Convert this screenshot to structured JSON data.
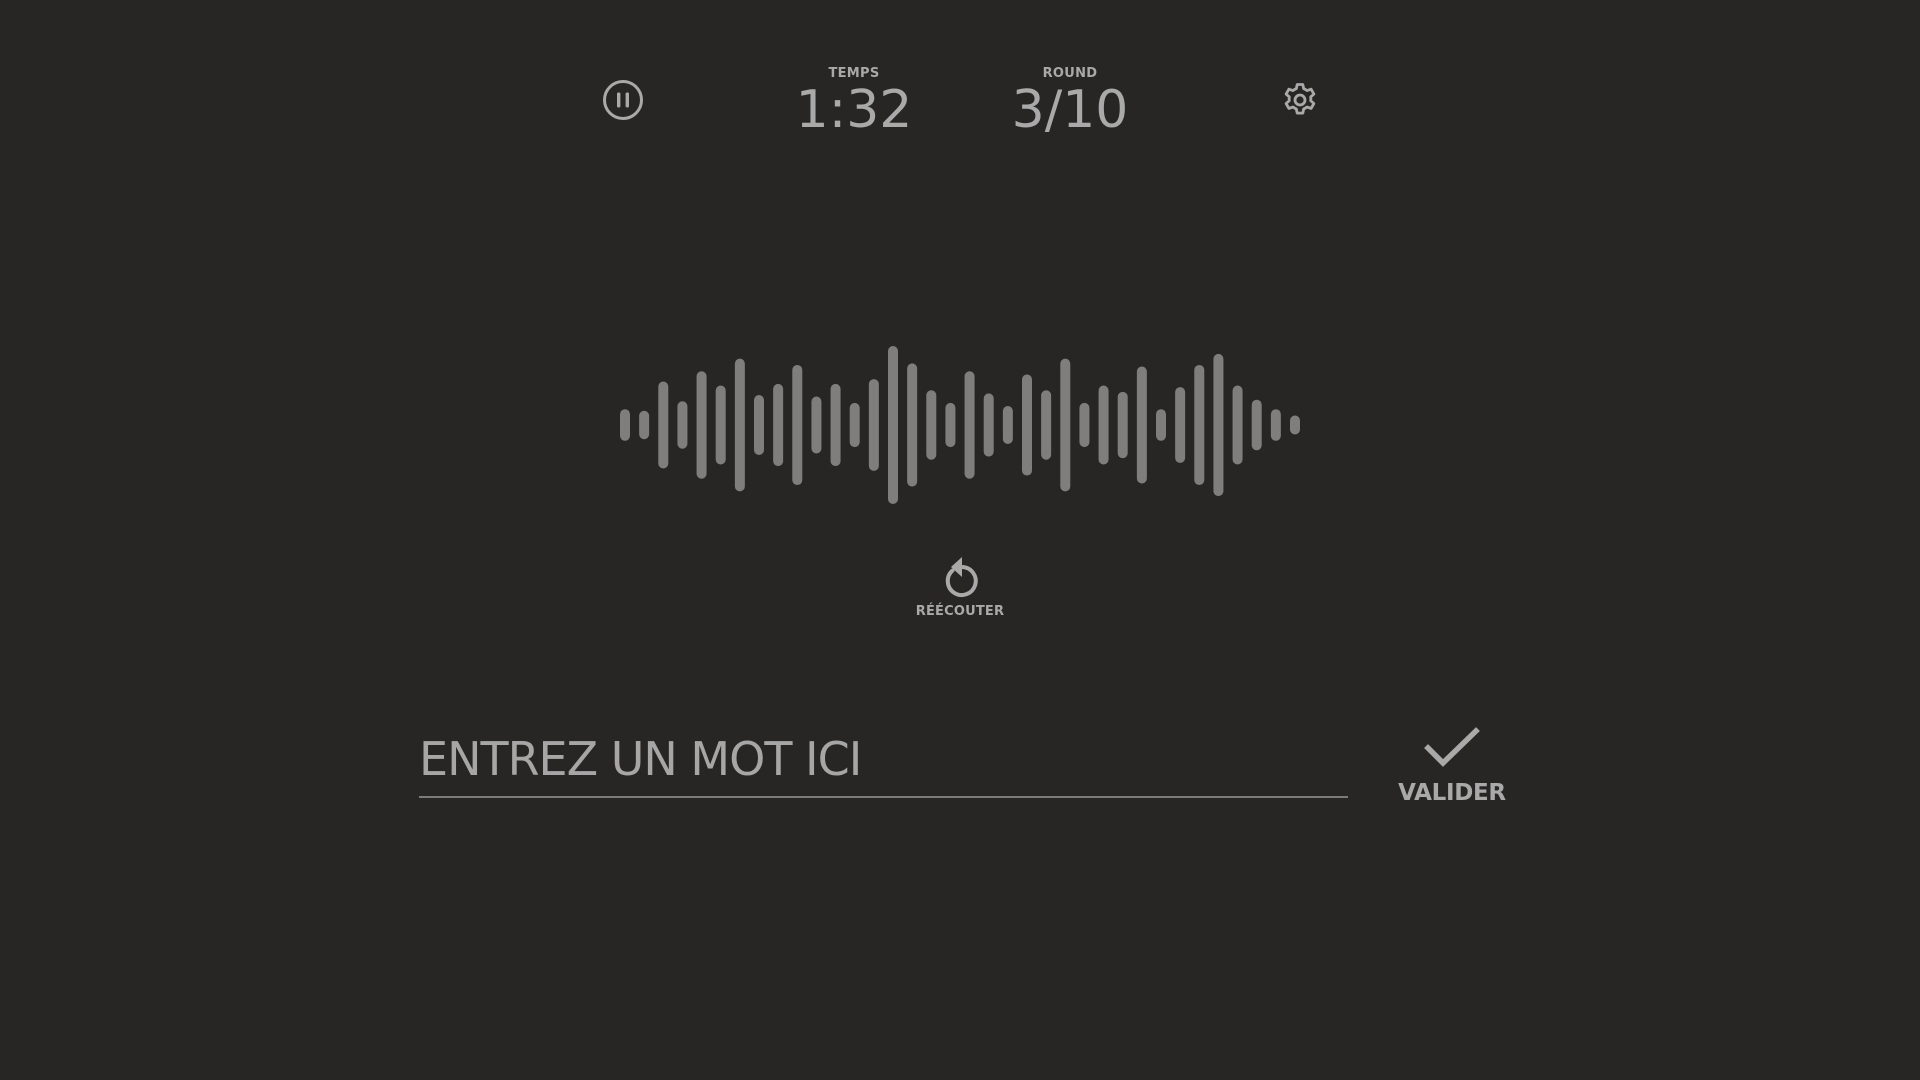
{
  "header": {
    "time_label": "TEMPS",
    "time_value": "1:32",
    "round_label": "ROUND",
    "round_value": "3/10",
    "pause_icon": "pause-circle-icon",
    "settings_icon": "gear-icon"
  },
  "waveform": {
    "levels": [
      0.2,
      0.18,
      0.55,
      0.3,
      0.68,
      0.5,
      0.84,
      0.38,
      0.52,
      0.76,
      0.36,
      0.52,
      0.28,
      0.58,
      1.0,
      0.78,
      0.44,
      0.28,
      0.68,
      0.4,
      0.24,
      0.64,
      0.44,
      0.84,
      0.28,
      0.5,
      0.42,
      0.74,
      0.2,
      0.48,
      0.76,
      0.9,
      0.5,
      0.32,
      0.2,
      0.12
    ]
  },
  "replay": {
    "label": "RÉÉCOUTER",
    "icon": "replay-icon"
  },
  "input": {
    "placeholder": "ENTREZ UN MOT ICI",
    "value": ""
  },
  "validate": {
    "label": "VALIDER",
    "icon": "check-icon"
  },
  "colors": {
    "background": "#282625",
    "foreground": "#a6a6a6",
    "waveform_bar": "#7f7e7d"
  }
}
